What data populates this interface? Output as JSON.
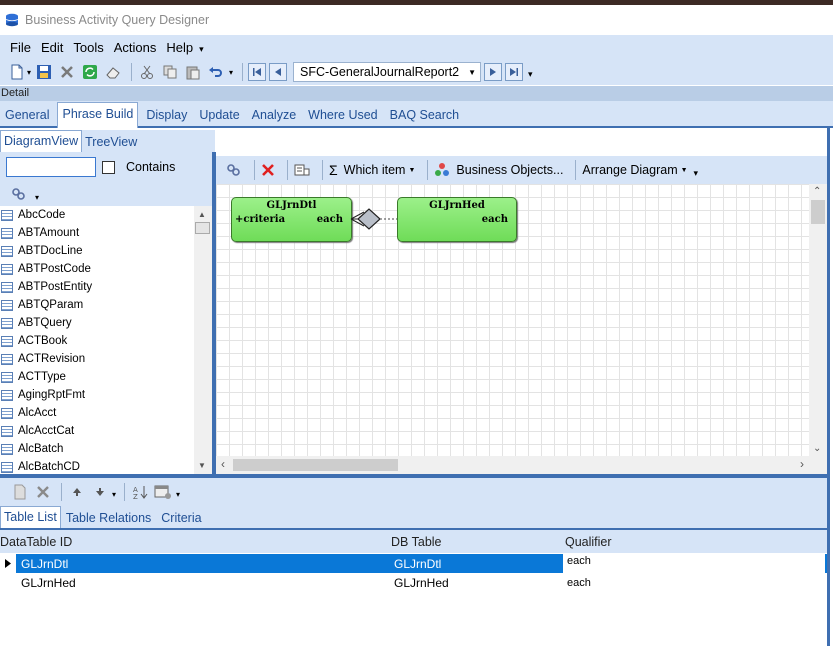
{
  "window": {
    "title": "Business Activity Query Designer"
  },
  "menu": [
    "File",
    "Edit",
    "Tools",
    "Actions",
    "Help"
  ],
  "toolbar": {
    "report_name": "SFC-GeneralJournalReport2"
  },
  "detail_label": "Detail",
  "main_tabs": [
    "General",
    "Phrase Build",
    "Display",
    "Update",
    "Analyze",
    "Where Used",
    "BAQ Search"
  ],
  "view_tabs": [
    "DiagramView",
    "TreeView"
  ],
  "search": {
    "value": "",
    "contains_label": "Contains"
  },
  "tables": [
    "AbcCode",
    "ABTAmount",
    "ABTDocLine",
    "ABTPostCode",
    "ABTPostEntity",
    "ABTQParam",
    "ABTQuery",
    "ACTBook",
    "ACTRevision",
    "ACTType",
    "AgingRptFmt",
    "AlcAcct",
    "AlcAcctCat",
    "AlcBatch",
    "AlcBatchCD"
  ],
  "diagram_toolbar": {
    "which_item": "Which item",
    "business_objects": "Business Objects...",
    "arrange_diagram": "Arrange Diagram",
    "sigma": "Σ"
  },
  "diagram": {
    "entities": [
      {
        "name": "GLJrnDtl",
        "left_label": "+criteria",
        "right_label": "each"
      },
      {
        "name": "GLJrnHed",
        "left_label": "",
        "right_label": "each"
      }
    ]
  },
  "bottom_tabs": [
    "Table List",
    "Table Relations",
    "Criteria"
  ],
  "grid": {
    "columns": [
      "DataTable ID",
      "DB Table",
      "Qualifier"
    ],
    "rows": [
      {
        "id": "GLJrnDtl",
        "db": "GLJrnDtl",
        "qualifier": "each",
        "selected": true
      },
      {
        "id": "GLJrnHed",
        "db": "GLJrnHed",
        "qualifier": "each",
        "selected": false
      }
    ]
  }
}
